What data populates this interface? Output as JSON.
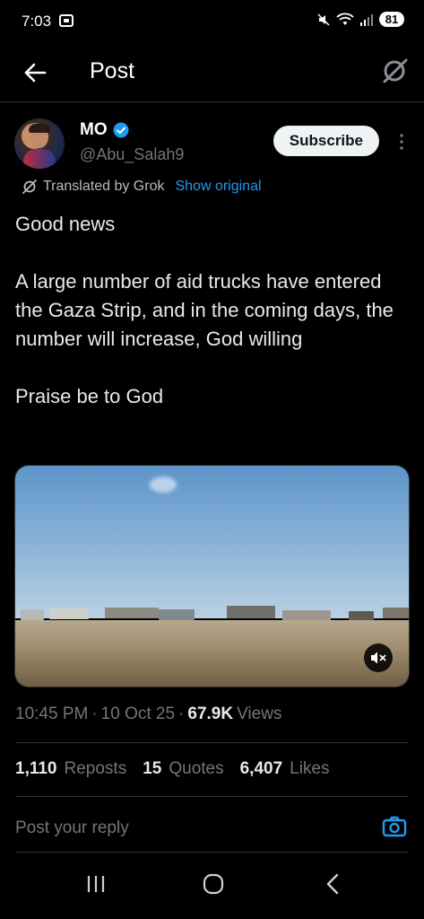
{
  "status_bar": {
    "time": "7:03",
    "battery": "81"
  },
  "header": {
    "title": "Post"
  },
  "author": {
    "name": "MO",
    "handle": "@Abu_Salah9",
    "subscribe_label": "Subscribe"
  },
  "translation": {
    "label": "Translated by Grok",
    "show_original": "Show original"
  },
  "tweet": {
    "paragraphs": [
      "Good news",
      "A large number of aid trucks have entered the Gaza Strip, and in the coming days, the number will increase, God willing",
      "Praise be to God"
    ]
  },
  "meta": {
    "time": "10:45 PM",
    "sep1": "·",
    "date": "10 Oct 25",
    "sep2": "·",
    "views_count": "67.9K",
    "views_label": "Views"
  },
  "stats": [
    {
      "count": "1,110",
      "label": "Reposts"
    },
    {
      "count": "15",
      "label": "Quotes"
    },
    {
      "count": "6,407",
      "label": "Likes"
    }
  ],
  "reply": {
    "placeholder": "Post your reply"
  },
  "colors": {
    "accent": "#1d9bf0",
    "background": "#000000",
    "muted": "#71767b",
    "divider": "#2f3336"
  },
  "icons": {
    "back": "back-arrow-icon",
    "grok": "grok-icon",
    "verified": "verified-icon",
    "more": "more-vertical-icon",
    "mute": "muted-speaker-icon",
    "camera": "camera-icon",
    "nav_recents": "recents-icon",
    "nav_home": "home-icon",
    "nav_back": "nav-back-icon"
  }
}
